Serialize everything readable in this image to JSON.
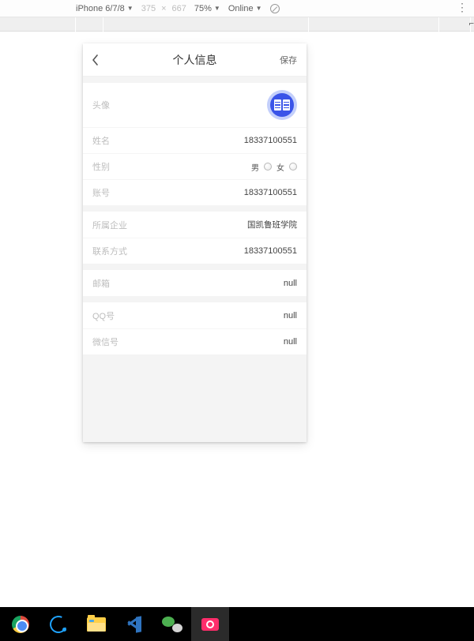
{
  "devtools": {
    "device": "iPhone 6/7/8",
    "width": "375",
    "height": "667",
    "zoom": "75%",
    "network": "Online"
  },
  "header": {
    "title": "个人信息",
    "save": "保存"
  },
  "section1": {
    "avatar_label": "头像",
    "name_label": "姓名",
    "name_value": "18337100551",
    "gender_label": "性别",
    "gender_male": "男",
    "gender_female": "女",
    "account_label": "账号",
    "account_value": "18337100551"
  },
  "section2": {
    "company_label": "所属企业",
    "company_value": "国凯鲁班学院",
    "contact_label": "联系方式",
    "contact_value": "18337100551"
  },
  "section3": {
    "email_label": "邮箱",
    "email_value": "null"
  },
  "section4": {
    "qq_label": "QQ号",
    "qq_value": "null",
    "wechat_label": "微信号",
    "wechat_value": "null"
  }
}
